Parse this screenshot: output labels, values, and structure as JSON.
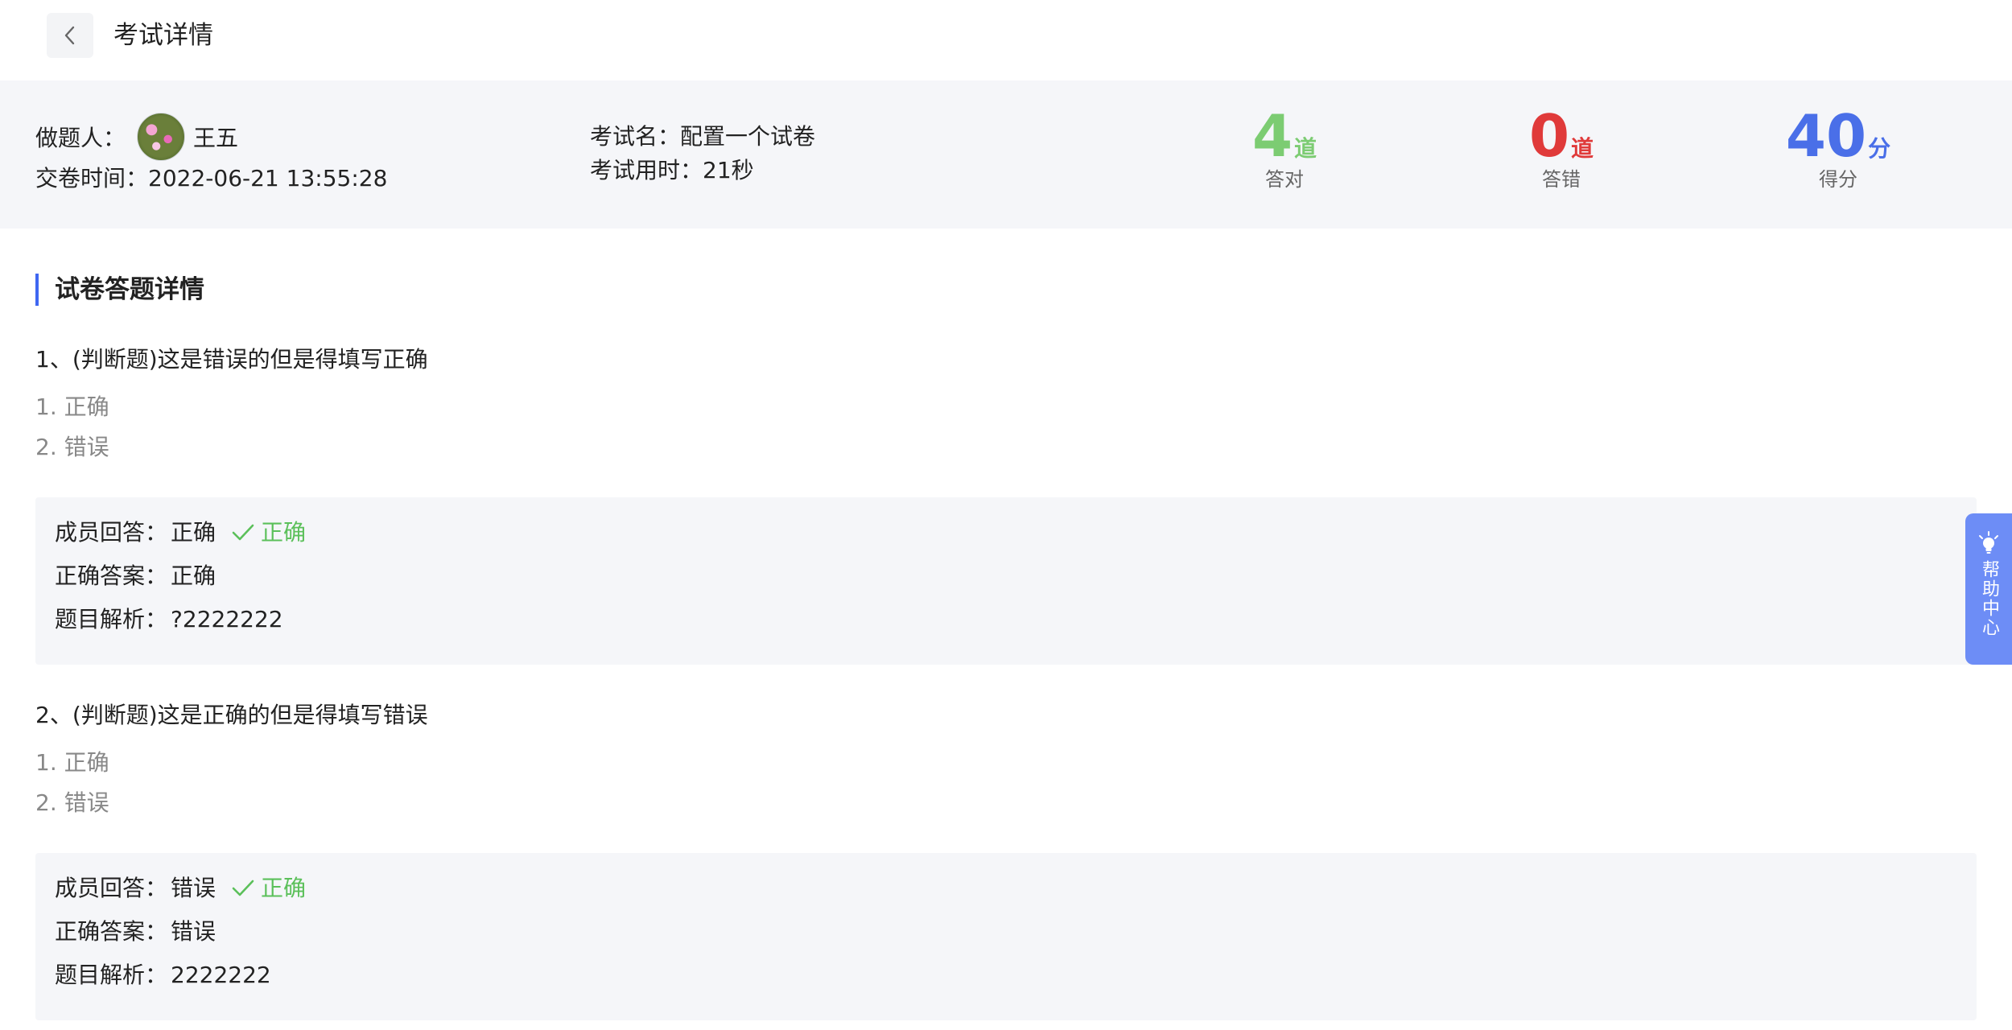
{
  "header": {
    "back_icon": "chevron-left-icon",
    "title": "考试详情"
  },
  "summary": {
    "user_label": "做题人：",
    "user_name": "王五",
    "submit_label": "交卷时间：",
    "submit_time": "2022-06-21 13:55:28",
    "exam_name_label": "考试名：",
    "exam_name": "配置一个试卷",
    "duration_label": "考试用时：",
    "duration": "21秒",
    "stats": [
      {
        "value": "4",
        "unit": "道",
        "caption": "答对",
        "color": "#7ccc72"
      },
      {
        "value": "0",
        "unit": "道",
        "caption": "答错",
        "color": "#e03a3a"
      },
      {
        "value": "40",
        "unit": "分",
        "caption": "得分",
        "color": "#4a6fe8"
      }
    ]
  },
  "section": {
    "title": "试卷答题详情"
  },
  "questions": [
    {
      "title": "1、(判断题)这是错误的但是得填写正确",
      "options": [
        "1. 正确",
        "2. 错误"
      ],
      "member_answer_label": "成员回答：",
      "member_answer": "正确",
      "result": "正确",
      "correct_answer_label": "正确答案：",
      "correct_answer": "正确",
      "analysis_label": "题目解析：",
      "analysis": "?2222222"
    },
    {
      "title": "2、(判断题)这是正确的但是得填写错误",
      "options": [
        "1. 正确",
        "2. 错误"
      ],
      "member_answer_label": "成员回答：",
      "member_answer": "错误",
      "result": "正确",
      "correct_answer_label": "正确答案：",
      "correct_answer": "错误",
      "analysis_label": "题目解析：",
      "analysis": "2222222"
    }
  ],
  "help": {
    "icon": "lightbulb-icon",
    "label": "帮助中心"
  },
  "colors": {
    "accent": "#3f67f2",
    "correct": "#5bc05a",
    "panel_bg": "#f5f6f9",
    "help_bg": "#6d8df6"
  }
}
